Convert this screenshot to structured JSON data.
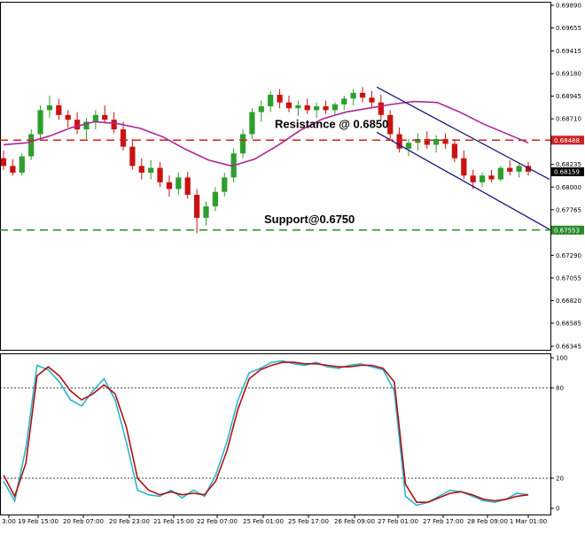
{
  "chart_data": [
    {
      "type": "candlestick",
      "ylim": [
        0.66345,
        0.6989
      ],
      "y_ticks": [
        "0.69890",
        "0.69655",
        "0.69415",
        "0.69180",
        "0.68945",
        "0.68710",
        "0.68235",
        "0.68000",
        "0.67765",
        "0.67530",
        "0.67290",
        "0.67055",
        "0.66820",
        "0.66585",
        "0.66345"
      ],
      "current_price": "0.68159",
      "annotations": [
        {
          "label": "Resistance @ 0.6850",
          "level": "0.68488",
          "color": "#cc2222"
        },
        {
          "label": "Support@0.6750",
          "level": "0.67553",
          "color": "#2d8a2d"
        }
      ],
      "colors": {
        "bull": "#2e9e2e",
        "bear": "#cc1111",
        "moving_average": "#b0259a",
        "channel": "#151580"
      },
      "channel_upper": [
        [
          0.6904,
          0.6808
        ]
      ],
      "channel_lower": [
        [
          0.6857,
          0.6756
        ]
      ],
      "moving_average": [
        0.6844,
        0.6846,
        0.6853,
        0.6862,
        0.6868,
        0.6866,
        0.6861,
        0.6852,
        0.6839,
        0.6828,
        0.6822,
        0.6829,
        0.6843,
        0.6859,
        0.6871,
        0.6878,
        0.6882,
        0.6886,
        0.6889,
        0.6888,
        0.6878,
        0.6866,
        0.6856,
        0.6846
      ],
      "candles": [
        [
          0.683,
          0.6838,
          0.6818,
          0.6822
        ],
        [
          0.6822,
          0.6829,
          0.6812,
          0.6815
        ],
        [
          0.6815,
          0.6835,
          0.6812,
          0.6832
        ],
        [
          0.6832,
          0.686,
          0.6828,
          0.6855
        ],
        [
          0.6855,
          0.6885,
          0.685,
          0.688
        ],
        [
          0.688,
          0.6895,
          0.6872,
          0.6885
        ],
        [
          0.6885,
          0.6892,
          0.687,
          0.6875
        ],
        [
          0.6875,
          0.688,
          0.6862,
          0.687
        ],
        [
          0.687,
          0.6878,
          0.6855,
          0.686
        ],
        [
          0.686,
          0.6872,
          0.685,
          0.6868
        ],
        [
          0.6868,
          0.688,
          0.686,
          0.6875
        ],
        [
          0.6875,
          0.6885,
          0.6866,
          0.687
        ],
        [
          0.687,
          0.6878,
          0.6856,
          0.686
        ],
        [
          0.686,
          0.6868,
          0.6838,
          0.6842
        ],
        [
          0.6842,
          0.685,
          0.6818,
          0.6822
        ],
        [
          0.6822,
          0.683,
          0.6808,
          0.6815
        ],
        [
          0.6815,
          0.6828,
          0.6808,
          0.682
        ],
        [
          0.682,
          0.6826,
          0.68,
          0.6805
        ],
        [
          0.6805,
          0.6812,
          0.679,
          0.6798
        ],
        [
          0.6798,
          0.6815,
          0.6792,
          0.681
        ],
        [
          0.681,
          0.6816,
          0.6788,
          0.6792
        ],
        [
          0.6792,
          0.6798,
          0.6752,
          0.6768
        ],
        [
          0.6768,
          0.6785,
          0.676,
          0.678
        ],
        [
          0.678,
          0.68,
          0.6775,
          0.6795
        ],
        [
          0.6795,
          0.6815,
          0.679,
          0.681
        ],
        [
          0.681,
          0.684,
          0.6805,
          0.6835
        ],
        [
          0.6835,
          0.686,
          0.683,
          0.6855
        ],
        [
          0.6855,
          0.6882,
          0.685,
          0.6878
        ],
        [
          0.6878,
          0.689,
          0.6868,
          0.6884
        ],
        [
          0.6884,
          0.69,
          0.6878,
          0.6896
        ],
        [
          0.6896,
          0.6902,
          0.6882,
          0.6888
        ],
        [
          0.6888,
          0.6895,
          0.6878,
          0.6882
        ],
        [
          0.6882,
          0.689,
          0.6874,
          0.6885
        ],
        [
          0.6885,
          0.6892,
          0.6876,
          0.688
        ],
        [
          0.688,
          0.6888,
          0.6872,
          0.6884
        ],
        [
          0.6884,
          0.689,
          0.6876,
          0.688
        ],
        [
          0.688,
          0.6888,
          0.6874,
          0.6886
        ],
        [
          0.6886,
          0.6895,
          0.688,
          0.6892
        ],
        [
          0.6892,
          0.6902,
          0.6885,
          0.6898
        ],
        [
          0.6898,
          0.6904,
          0.6888,
          0.6893
        ],
        [
          0.6893,
          0.69,
          0.6882,
          0.6888
        ],
        [
          0.6888,
          0.6896,
          0.687,
          0.6875
        ],
        [
          0.6875,
          0.688,
          0.685,
          0.6855
        ],
        [
          0.6855,
          0.6862,
          0.6836,
          0.684
        ],
        [
          0.684,
          0.685,
          0.6832,
          0.6846
        ],
        [
          0.6846,
          0.6856,
          0.6838,
          0.685
        ],
        [
          0.685,
          0.6858,
          0.684,
          0.6844
        ],
        [
          0.6844,
          0.6854,
          0.6836,
          0.685
        ],
        [
          0.685,
          0.6856,
          0.684,
          0.6845
        ],
        [
          0.6845,
          0.685,
          0.6826,
          0.683
        ],
        [
          0.683,
          0.6838,
          0.6808,
          0.6812
        ],
        [
          0.6812,
          0.6818,
          0.6798,
          0.6805
        ],
        [
          0.6805,
          0.6815,
          0.68,
          0.6812
        ],
        [
          0.6812,
          0.6818,
          0.6805,
          0.6808
        ],
        [
          0.6808,
          0.6822,
          0.6806,
          0.682
        ],
        [
          0.682,
          0.6828,
          0.6812,
          0.6816
        ],
        [
          0.6816,
          0.6824,
          0.681,
          0.6822
        ],
        [
          0.6822,
          0.6826,
          0.6812,
          0.6816
        ]
      ]
    },
    {
      "type": "line",
      "x_ticks": [
        "3:00",
        "19 Feb 15:00",
        "20 Feb 07:00",
        "20 Feb 23:00",
        "21 Feb 15:00",
        "22 Feb 07:00",
        "25 Feb 01:00",
        "25 Feb 17:00",
        "26 Feb 09:00",
        "27 Feb 01:00",
        "27 Feb 17:00",
        "28 Feb 09:00",
        "1 Mar 01:00"
      ],
      "y_ticks": [
        "100",
        "80",
        "20",
        "0"
      ],
      "ylim": [
        0,
        100
      ],
      "levels": [
        80,
        20
      ],
      "series": [
        {
          "color": "#2ab6cf",
          "values": [
            18,
            5,
            40,
            95,
            92,
            84,
            72,
            68,
            78,
            86,
            72,
            44,
            12,
            9,
            8,
            12,
            7,
            12,
            8,
            22,
            44,
            72,
            90,
            93,
            97,
            98,
            96,
            95,
            97,
            94,
            93,
            95,
            96,
            94,
            92,
            78,
            8,
            2,
            4,
            8,
            12,
            11,
            8,
            5,
            4,
            6,
            10,
            9
          ]
        },
        {
          "color": "#b01010",
          "values": [
            22,
            8,
            30,
            88,
            94,
            88,
            78,
            72,
            76,
            82,
            76,
            54,
            20,
            12,
            9,
            11,
            9,
            10,
            9,
            18,
            38,
            66,
            86,
            92,
            95,
            97,
            97,
            96,
            96,
            95,
            94,
            94,
            95,
            95,
            93,
            84,
            16,
            4,
            4,
            7,
            10,
            11,
            9,
            6,
            5,
            6,
            8,
            9
          ]
        }
      ]
    }
  ]
}
